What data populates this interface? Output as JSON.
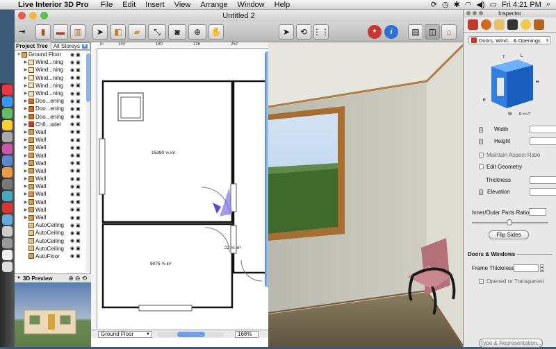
{
  "menubar": {
    "app": "Live Interior 3D Pro",
    "items": [
      "File",
      "Edit",
      "Insert",
      "View",
      "Arrange",
      "Window",
      "Help"
    ],
    "clock": "Fri 4:21 PM"
  },
  "window": {
    "title": "Untitled 2"
  },
  "project_tree": {
    "label": "Project Tree",
    "storeys_select": "All Storeys",
    "root": "Ground Floor",
    "items": [
      {
        "label": "Wind...ning",
        "icon": "window-icon"
      },
      {
        "label": "Wind...ning",
        "icon": "window-icon"
      },
      {
        "label": "Wind...ning",
        "icon": "window-icon"
      },
      {
        "label": "Wind...ning",
        "icon": "window-icon"
      },
      {
        "label": "Wind...ning",
        "icon": "window-icon"
      },
      {
        "label": "Doo...ening",
        "icon": "door-icon"
      },
      {
        "label": "Doo...ening",
        "icon": "door-icon"
      },
      {
        "label": "Doo...ening",
        "icon": "door-icon"
      },
      {
        "label": "Ch6...odel",
        "icon": "chair-icon"
      },
      {
        "label": "Wall",
        "icon": "wall-icon"
      },
      {
        "label": "Wall",
        "icon": "wall-icon"
      },
      {
        "label": "Wall",
        "icon": "wall-icon"
      },
      {
        "label": "Wall",
        "icon": "wall-icon"
      },
      {
        "label": "Wall",
        "icon": "wall-icon"
      },
      {
        "label": "Wall",
        "icon": "wall-icon"
      },
      {
        "label": "Wall",
        "icon": "wall-icon"
      },
      {
        "label": "Wall",
        "icon": "wall-icon"
      },
      {
        "label": "Wall",
        "icon": "wall-icon"
      },
      {
        "label": "Wall",
        "icon": "wall-icon"
      },
      {
        "label": "Wall",
        "icon": "wall-icon"
      },
      {
        "label": "Wall",
        "icon": "wall-icon"
      },
      {
        "label": "AutoCeiling",
        "icon": "ceiling-icon"
      },
      {
        "label": "AutoCeiling",
        "icon": "ceiling-icon"
      },
      {
        "label": "AutoCeiling",
        "icon": "ceiling-icon"
      },
      {
        "label": "AutoCeiling",
        "icon": "ceiling-icon"
      },
      {
        "label": "AutoFloor",
        "icon": "floor-icon"
      }
    ]
  },
  "preview": {
    "label": "3D Preview"
  },
  "plan": {
    "ruler_labels": [
      "144",
      "180",
      "216",
      "252"
    ],
    "room1_area": "15390 ⅛ in²",
    "room2_area": "9075 ⅜ in²",
    "room3_area": "22 ⅞ in²",
    "level_select": "Ground Floor",
    "zoom": "168%"
  },
  "inspector": {
    "title": "Inspector",
    "category_select": "Doors, Wind... & Openings",
    "diagram_labels": {
      "t": "T",
      "l": "L",
      "h": "H",
      "e": "E",
      "w": "W",
      "r": "R = L/T"
    },
    "width_label": "Width",
    "height_label": "Height",
    "aspect_label": "Maintain Aspect Ratio",
    "edit_geometry": "Edit Geometry",
    "thickness_label": "Thickness",
    "elevation_label": "Elevation",
    "ratio_label": "Inner/Outer Parts Ratio",
    "flip_button": "Flip Sides",
    "section_title": "Doors & Windows",
    "frame_label": "Frame Thickness",
    "opened_label": "Opened or Transparent",
    "type_button": "Type & Representation..."
  }
}
